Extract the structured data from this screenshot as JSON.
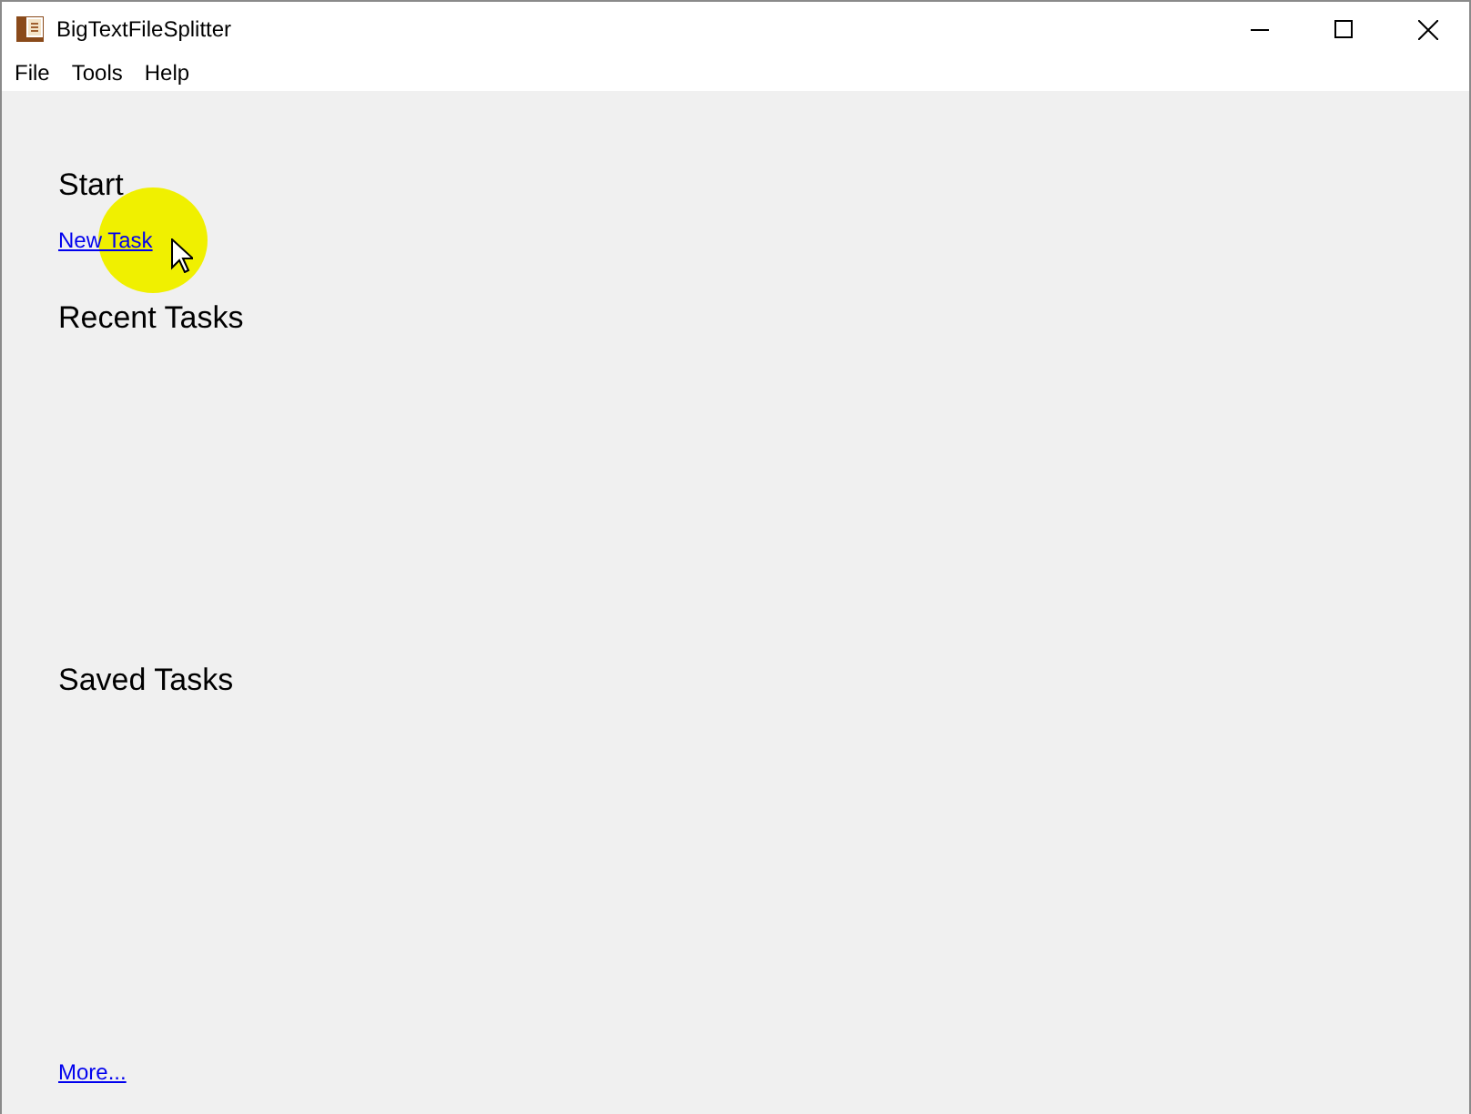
{
  "window": {
    "title": "BigTextFileSplitter"
  },
  "menu": [
    "File",
    "Tools",
    "Help"
  ],
  "start": {
    "heading": "Start",
    "link": "New Task"
  },
  "recent": {
    "heading": "Recent Tasks"
  },
  "saved": {
    "heading": "Saved Tasks"
  },
  "more_link": "More..."
}
